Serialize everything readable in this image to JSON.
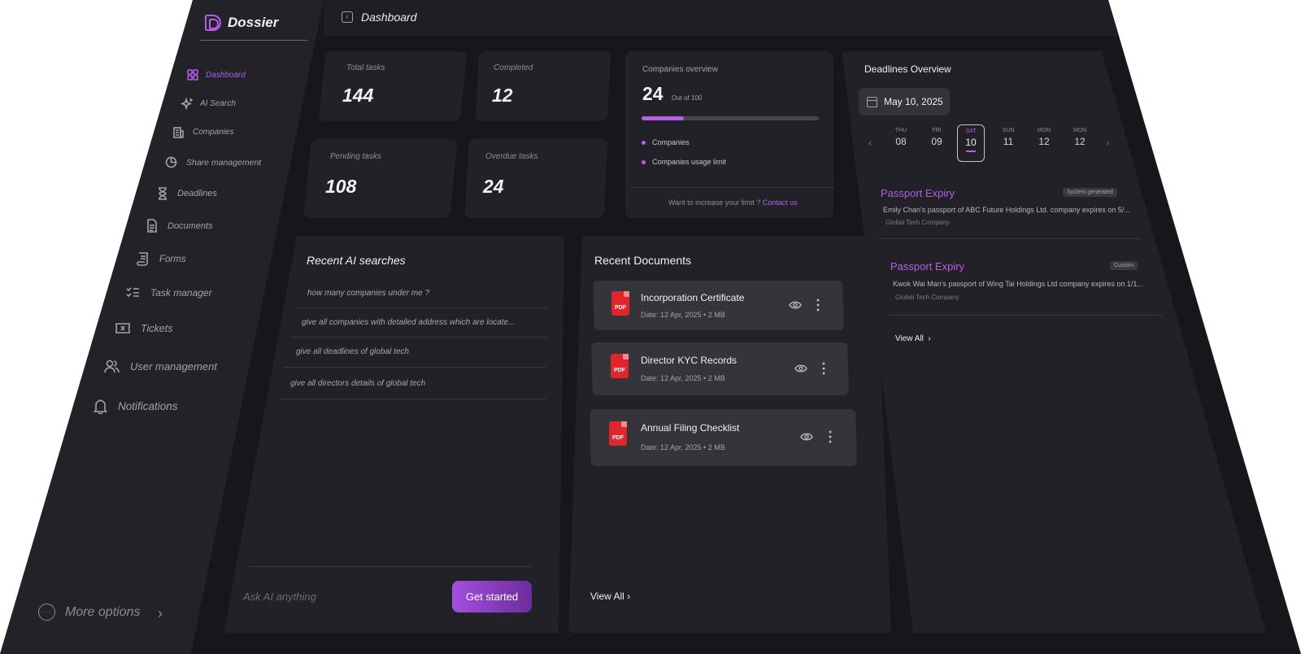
{
  "app": {
    "name": "Dossier"
  },
  "sidebar": {
    "items": [
      {
        "label": "Dashboard",
        "icon": "grid-icon",
        "active": true
      },
      {
        "label": "AI Search",
        "icon": "sparkle-icon"
      },
      {
        "label": "Companies",
        "icon": "building-icon"
      },
      {
        "label": "Share management",
        "icon": "pie-chart-icon"
      },
      {
        "label": "Deadlines",
        "icon": "hourglass-icon"
      },
      {
        "label": "Documents",
        "icon": "document-icon"
      },
      {
        "label": "Forms",
        "icon": "scroll-icon"
      },
      {
        "label": "Task manager",
        "icon": "checklist-icon"
      },
      {
        "label": "Tickets",
        "icon": "ticket-icon"
      },
      {
        "label": "User management",
        "icon": "users-icon"
      },
      {
        "label": "Notifications",
        "icon": "bell-icon"
      }
    ],
    "more_options": "More options"
  },
  "header": {
    "title": "Dashboard"
  },
  "stats": {
    "total_tasks": {
      "label": "Total tasks",
      "value": "144"
    },
    "completed": {
      "label": "Completed",
      "value": "12"
    },
    "pending_tasks": {
      "label": "Pending tasks",
      "value": "108"
    },
    "overdue_tasks": {
      "label": "Overdue tasks",
      "value": "24"
    }
  },
  "companies_overview": {
    "title": "Companies overview",
    "count": "24",
    "out_of": "Out of 100",
    "progress": 0.24,
    "legend": [
      "Companies",
      "Companies usage limit"
    ],
    "footer_text": "Want to increase your limit ?",
    "footer_link": "Contact us"
  },
  "recent_ai": {
    "title": "Recent AI searches",
    "items": [
      "how many companies under me ?",
      "give all companies with detailed address which are locate...",
      "give all deadlines of global tech",
      "give all directors details of global tech"
    ],
    "input_placeholder": "Ask AI anything",
    "button": "Get started"
  },
  "recent_documents": {
    "title": "Recent Documents",
    "file_badge": "PDF",
    "items": [
      {
        "name": "Incorporation Certificate",
        "meta": "Date:  12 Apr, 2025  •  2 MB"
      },
      {
        "name": "Director KYC Records",
        "meta": "Date:  12 Apr, 2025  •  2 MB"
      },
      {
        "name": "Annual Filing Checklist",
        "meta": "Date:  12 Apr, 2025  •  2 MB"
      }
    ],
    "view_all": "View All"
  },
  "deadlines": {
    "title": "Deadlines Overview",
    "selected_date": "May 10, 2025",
    "days": [
      {
        "name": "THU",
        "num": "08"
      },
      {
        "name": "FRI",
        "num": "09"
      },
      {
        "name": "SAT",
        "num": "10",
        "selected": true
      },
      {
        "name": "SUN",
        "num": "11"
      },
      {
        "name": "MON",
        "num": "12"
      },
      {
        "name": "MON",
        "num": "12"
      }
    ],
    "items": [
      {
        "title": "Passport Expiry",
        "badge": "System generated",
        "description": "Emily Chan's passport of ABC Future Holdings Ltd. company expires on 5/...",
        "company": "Global Tech Company"
      },
      {
        "title": "Passport Expiry",
        "badge": "Custom",
        "description": "Kwok Wai Man's passport of Wing Tai Holdings Ltd company expires on 1/1...",
        "company": "Global Tech Company"
      }
    ],
    "view_all": "View All"
  },
  "colors": {
    "accent": "#b45fe8",
    "background": "#17161b",
    "card": "#222127",
    "pdf_red": "#e0262d"
  }
}
